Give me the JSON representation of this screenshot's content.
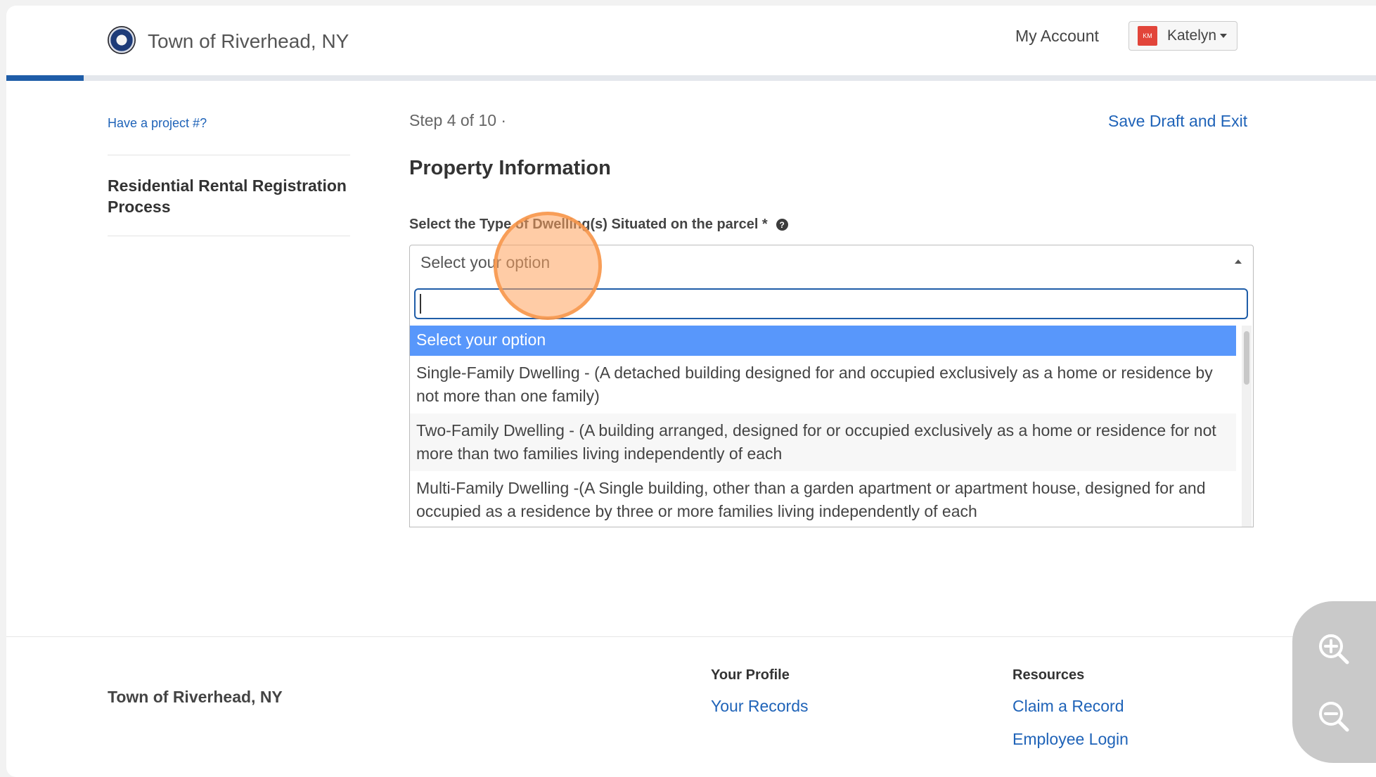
{
  "header": {
    "brand": "Town of Riverhead, NY",
    "my_account": "My Account",
    "user": {
      "initials": "KM",
      "name": "Katelyn"
    },
    "progress_fraction": 0.4
  },
  "sidebar": {
    "project_link": "Have a project #?",
    "process_title": "Residential Rental Registration Process"
  },
  "main": {
    "step": "Step 4 of 10 ·",
    "save_draft": "Save Draft and Exit",
    "section_title": "Property Information",
    "field_label": "Select the Type of Dwelling(s) Situated on the parcel *",
    "help_glyph": "?",
    "select": {
      "selected": "Select your option",
      "search_value": "",
      "options": [
        "Select your option",
        "Single-Family Dwelling - (A detached building designed for and occupied exclusively as a home or residence by not more than one family)",
        "Two-Family Dwelling - (A building arranged, designed for or occupied exclusively as a home or residence for not more than two families living independently of each",
        "Multi-Family Dwelling -(A Single building, other than a garden apartment or apartment house, designed for and occupied as a residence by three or more families living independently of each"
      ]
    }
  },
  "footer": {
    "brand": "Town of Riverhead, NY",
    "col1": {
      "heading": "Your Profile",
      "links": [
        "Your Records"
      ]
    },
    "col2": {
      "heading": "Resources",
      "links": [
        "Claim a Record",
        "Employee Login"
      ]
    }
  },
  "colors": {
    "accent": "#1f5da8",
    "link": "#1f63b8",
    "option_highlight": "#5897fb",
    "click_highlight": "#f7964b"
  },
  "icons": [
    "seal-logo-icon",
    "help-circle-icon",
    "caret-up-icon",
    "caret-down-icon",
    "zoom-in-icon",
    "zoom-out-icon"
  ]
}
